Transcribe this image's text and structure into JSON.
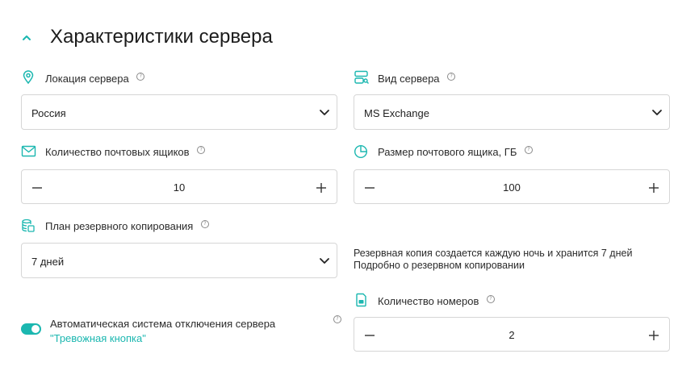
{
  "section": {
    "title": "Характеристики сервера"
  },
  "location": {
    "label": "Локация сервера",
    "value": "Россия",
    "icon": "location-pin-icon"
  },
  "server_type": {
    "label": "Вид сервера",
    "value": "MS Exchange",
    "icon": "server-icon"
  },
  "mailboxes": {
    "label": "Количество почтовых ящиков",
    "value": "10",
    "icon": "envelope-icon"
  },
  "mailbox_size": {
    "label": "Размер почтового ящика, ГБ",
    "value": "100",
    "icon": "pie-chart-icon"
  },
  "backup": {
    "label": "План резервного копирования",
    "value": "7 дней",
    "icon": "database-icon",
    "note": "Резервная копия создается каждую ночь и хранится 7 дней",
    "link": "Подробно о резервном копировании"
  },
  "numbers": {
    "label": "Количество номеров",
    "value": "2",
    "icon": "sim-card-icon"
  },
  "shutdown": {
    "text": "Автоматическая система отключения сервера",
    "link": "\"Тревожная кнопка\"",
    "enabled": true
  },
  "help_glyph": "?",
  "colors": {
    "accent": "#1bb7b0",
    "border": "#d6d6d6",
    "text": "#1f1f1f"
  }
}
